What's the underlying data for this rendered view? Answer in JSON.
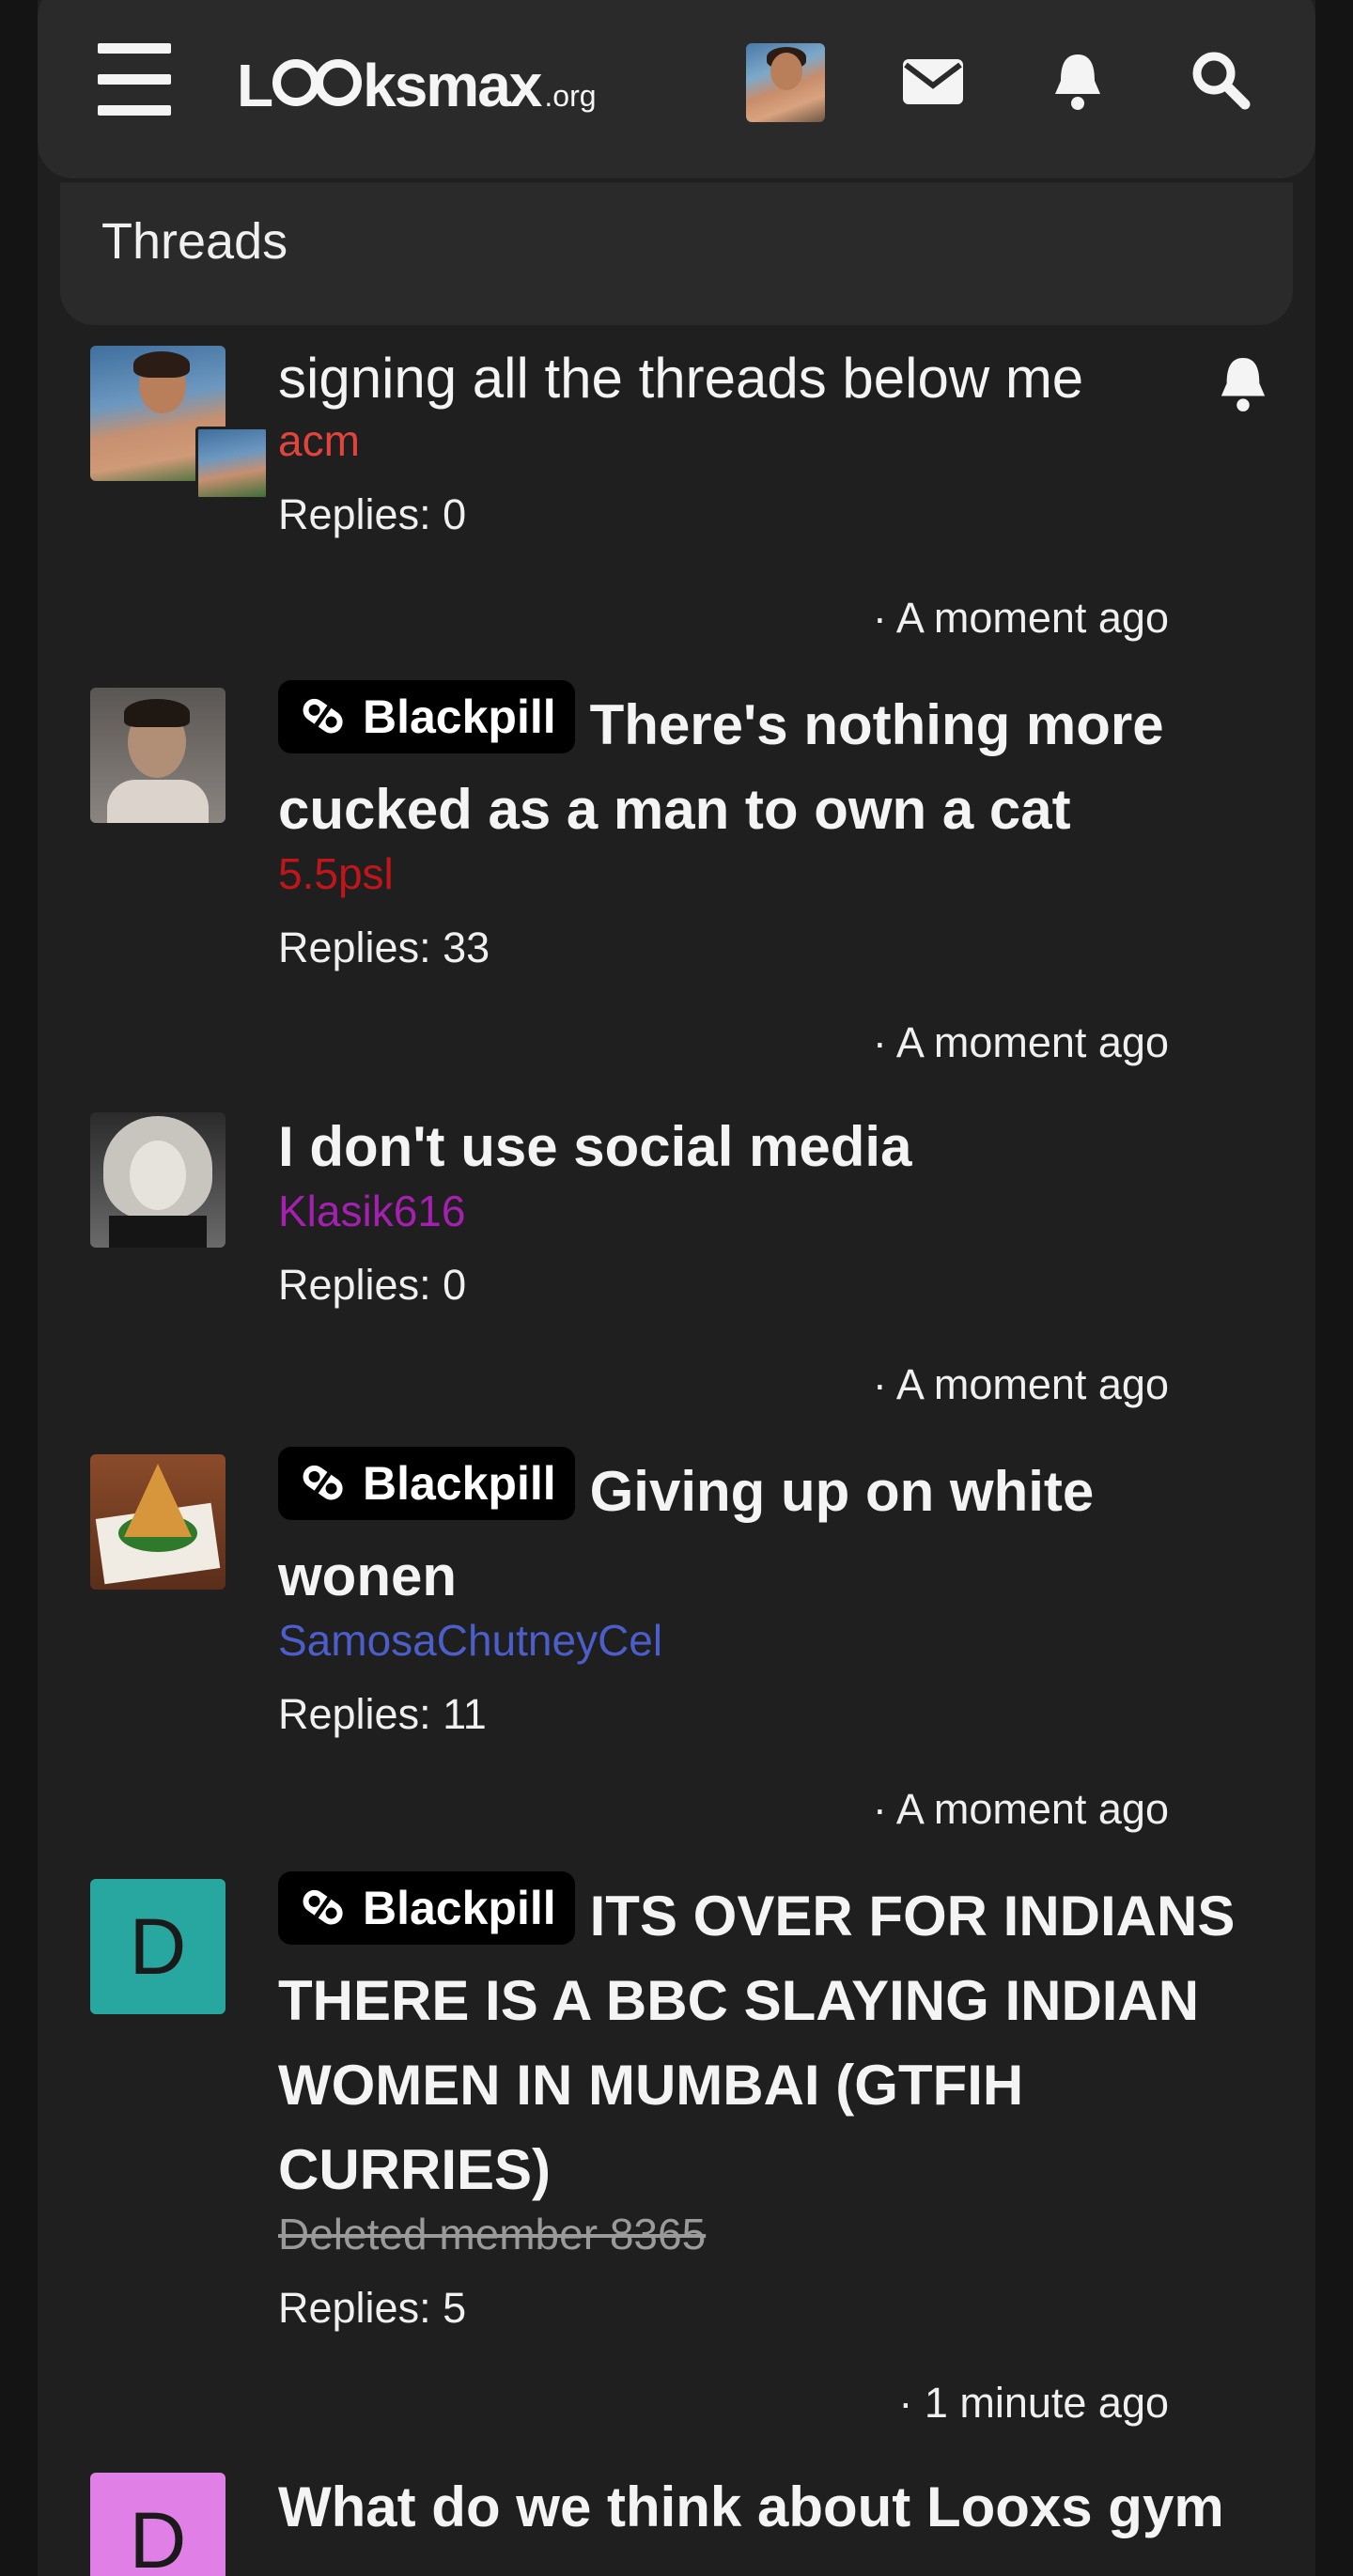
{
  "header": {
    "logo_main": "L",
    "logo_rest": "ksmax",
    "logo_tld": ".org",
    "icons": [
      "menu-icon",
      "envelope-icon",
      "bell-icon",
      "search-icon"
    ]
  },
  "section": {
    "title": "Threads"
  },
  "threads": [
    {
      "title": "signing all the threads below me",
      "author": "acm",
      "author_color": "#e0443c",
      "replies": "Replies: 0",
      "time": "· A moment ago",
      "watched": true
    },
    {
      "prefix": "Blackpill",
      "title": "There's nothing more cucked as a man to own a cat",
      "author": "5.5psl",
      "author_color": "#c0161a",
      "replies": "Replies: 33",
      "time": "· A moment ago"
    },
    {
      "title": "I don't use social media",
      "author": "Klasik616",
      "author_color": "#a51fb0",
      "replies": "Replies: 0",
      "time": "· A moment ago"
    },
    {
      "prefix": "Blackpill",
      "title": "Giving up on white wonen",
      "author": "SamosaChutneyCel",
      "author_color": "#4b5ec9",
      "replies": "Replies: 11",
      "time": "· A moment ago"
    },
    {
      "prefix": "Blackpill",
      "title": "ITS OVER FOR INDIANS THERE IS A BBC SLAYING INDIAN WOMEN IN MUMBAI (GTFIH CURRIES)",
      "author": "Deleted member 8365",
      "author_color": "#9a9a9a",
      "avatar_letter": "D",
      "avatar_color": "#27a7a0",
      "replies": "Replies: 5",
      "time": "· 1 minute ago"
    },
    {
      "title": "What do we think about Looxs gym",
      "avatar_letter": "D",
      "avatar_color": "#e07fe6"
    }
  ]
}
